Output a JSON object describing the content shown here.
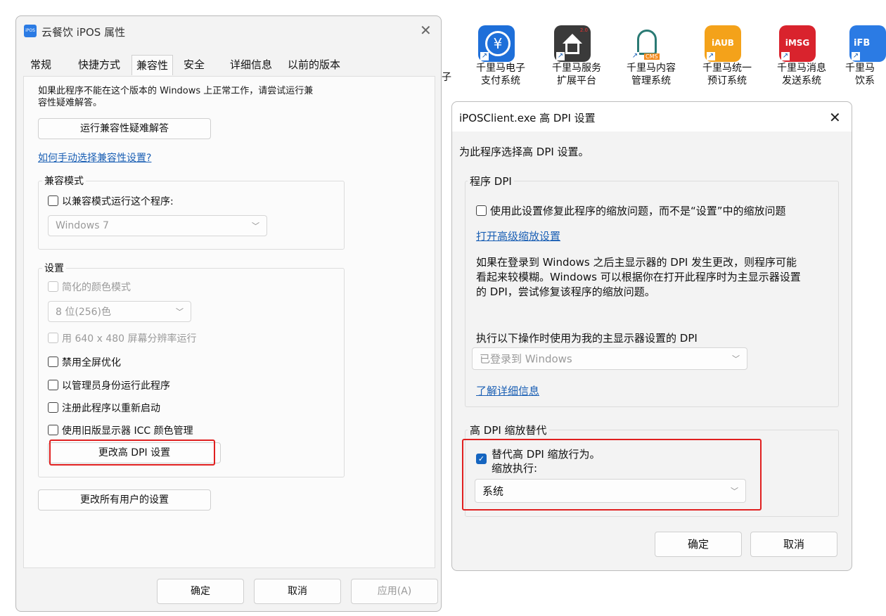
{
  "props_dialog": {
    "title": "云餐饮 iPOS 属性",
    "tabs": [
      "常规",
      "快捷方式",
      "兼容性",
      "安全",
      "详细信息",
      "以前的版本"
    ],
    "intro": [
      "如果此程序不能在这个版本的 Windows 上正常工作，请尝试运行兼",
      "容性疑难解答。"
    ],
    "run_troubleshooter": "运行兼容性疑难解答",
    "manual_link": "如何手动选择兼容性设置?",
    "compat_group": {
      "label": "兼容模式",
      "checkbox": "以兼容模式运行这个程序:",
      "os_value": "Windows 7"
    },
    "settings_group": {
      "label": "设置",
      "reduced_color": "简化的颜色模式",
      "color_value": "8 位(256)色",
      "res_640": "用 640 x 480 屏幕分辨率运行",
      "disable_fullscreen": "禁用全屏优化",
      "run_admin": "以管理员身份运行此程序",
      "register_restart": "注册此程序以重新启动",
      "legacy_icc": "使用旧版显示器 ICC 颜色管理",
      "change_dpi": "更改高 DPI 设置"
    },
    "change_all_users": "更改所有用户的设置",
    "ok": "确定",
    "cancel": "取消",
    "apply": "应用(A)"
  },
  "desktop": {
    "partial_left": [
      "子",
      ""
    ],
    "icons": [
      {
        "line1": "千里马电子",
        "line2": "支付系统",
        "icon": "yuan-icon",
        "color": "#1e6fd9",
        "badge": ""
      },
      {
        "line1": "千里马服务",
        "line2": "扩展平台",
        "icon": "house-icon",
        "color": "#3a3a3a",
        "badge": "2.0"
      },
      {
        "line1": "千里马内容",
        "line2": "管理系统",
        "icon": "horse-icon",
        "color": "#ffffff",
        "badge": "CMS"
      },
      {
        "line1": "千里马统一",
        "line2": "预订系统",
        "icon": "iaub-icon",
        "color": "#f4a21a",
        "badge": "iAUB"
      },
      {
        "line1": "千里马消息",
        "line2": "发送系统",
        "icon": "imsg-icon",
        "color": "#d9232d",
        "badge": "iMSG"
      },
      {
        "line1": "千里马",
        "line2": "饮系",
        "icon": "ifb-icon",
        "color": "#2b7be4",
        "badge": "iFB"
      }
    ]
  },
  "dpi_dialog": {
    "title": "iPOSClient.exe 高 DPI 设置",
    "heading": "为此程序选择高 DPI 设置。",
    "program_dpi": {
      "label": "程序 DPI",
      "checkbox": "使用此设置修复此程序的缩放问题，而不是“设置”中的缩放问题",
      "advanced_link": "打开高级缩放设置",
      "description": [
        "如果在登录到 Windows 之后主显示器的 DPI 发生更改，则程序可能",
        "看起来较模糊。Windows 可以根据你在打开此程序时为主显示器设置",
        "的 DPI，尝试修复该程序的缩放问题。"
      ],
      "use_dpi_label": "执行以下操作时使用为我的主显示器设置的 DPI",
      "use_dpi_value": "已登录到 Windows",
      "learn_more": "了解详细信息"
    },
    "override": {
      "label": "高 DPI 缩放替代",
      "checkbox": "替代高 DPI 缩放行为。",
      "performed_by": "缩放执行:",
      "value": "系统"
    },
    "ok": "确定",
    "cancel": "取消"
  }
}
